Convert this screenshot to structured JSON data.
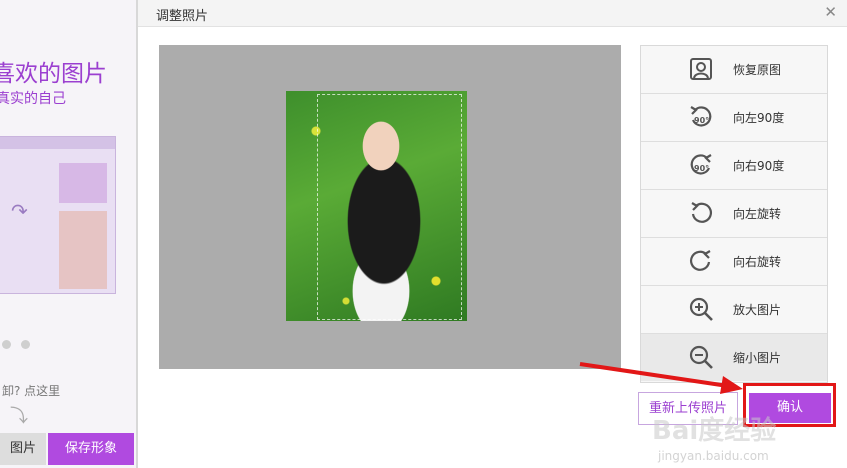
{
  "background": {
    "title": "喜欢的图片",
    "subtitle": "真实的自己",
    "help_text": "卸? 点这里",
    "photo_button": "图片",
    "save_button": "保存形象"
  },
  "dialog": {
    "title": "调整照片",
    "close_icon": "close-icon",
    "tools": [
      {
        "label": "恢复原图",
        "icon": "portrait-reset-icon"
      },
      {
        "label": "向左90度",
        "icon": "rotate-left-90-icon"
      },
      {
        "label": "向右90度",
        "icon": "rotate-right-90-icon"
      },
      {
        "label": "向左旋转",
        "icon": "rotate-left-icon"
      },
      {
        "label": "向右旋转",
        "icon": "rotate-right-icon"
      },
      {
        "label": "放大图片",
        "icon": "zoom-in-icon"
      },
      {
        "label": "缩小图片",
        "icon": "zoom-out-icon"
      }
    ],
    "reupload_button": "重新上传照片",
    "confirm_button": "确认"
  },
  "watermark": {
    "text": "Bai度经验",
    "sub": "jingyan.baidu.com"
  },
  "colors": {
    "accent": "#b04ae0",
    "annotation": "#e21717"
  }
}
